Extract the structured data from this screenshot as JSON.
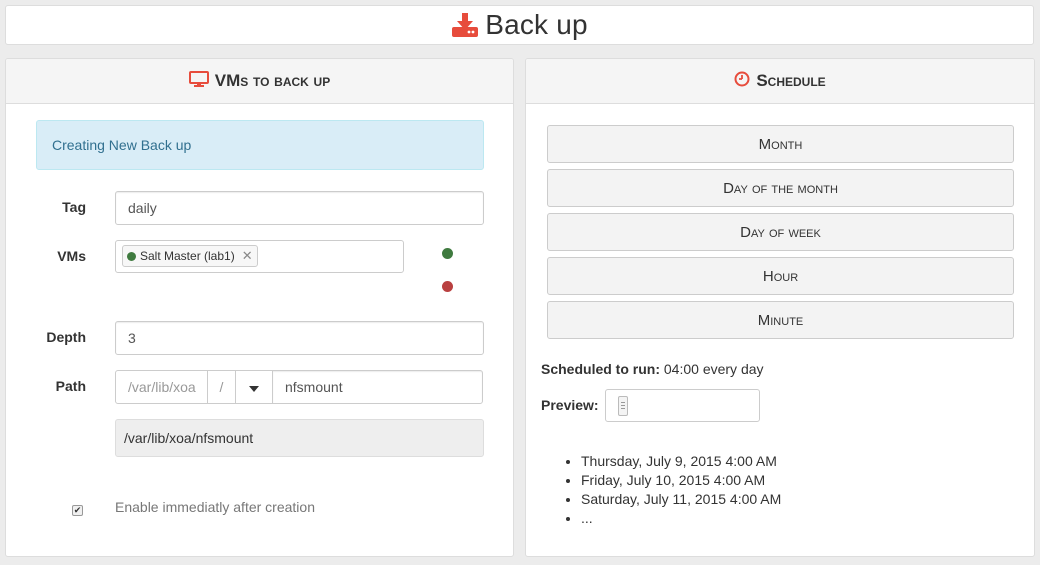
{
  "page": {
    "title": "Back up",
    "icon": "download-icon",
    "accent_color": "#e74c3c"
  },
  "vms_panel": {
    "heading": "VMs to back up",
    "icon": "monitor-icon",
    "alert_text": "Creating New Back up",
    "tag_label": "Tag",
    "tag_value": "daily",
    "vms_label": "VMs",
    "selected_vm": "Salt Master (lab1)",
    "selected_vm_status_color": "#3f7a3f",
    "remove_glyph": "✕",
    "depth_label": "Depth",
    "depth_value": "3",
    "path_label": "Path",
    "path_prefix": "/var/lib/xoa",
    "path_separator": "/",
    "path_value": "nfsmount",
    "full_path": "/var/lib/xoa/nfsmount",
    "enable_label": "Enable immediatly after creation",
    "enable_checked": true
  },
  "schedule_panel": {
    "heading": "Schedule",
    "icon": "clock-icon",
    "buttons": [
      "Month",
      "Day of the month",
      "Day of week",
      "Hour",
      "Minute"
    ],
    "scheduled_label": "Scheduled to run:",
    "scheduled_value": "04:00 every day",
    "preview_label": "Preview:",
    "preview_items": [
      "Thursday, July 9, 2015 4:00 AM",
      "Friday, July 10, 2015 4:00 AM",
      "Saturday, July 11, 2015 4:00 AM",
      "..."
    ]
  }
}
